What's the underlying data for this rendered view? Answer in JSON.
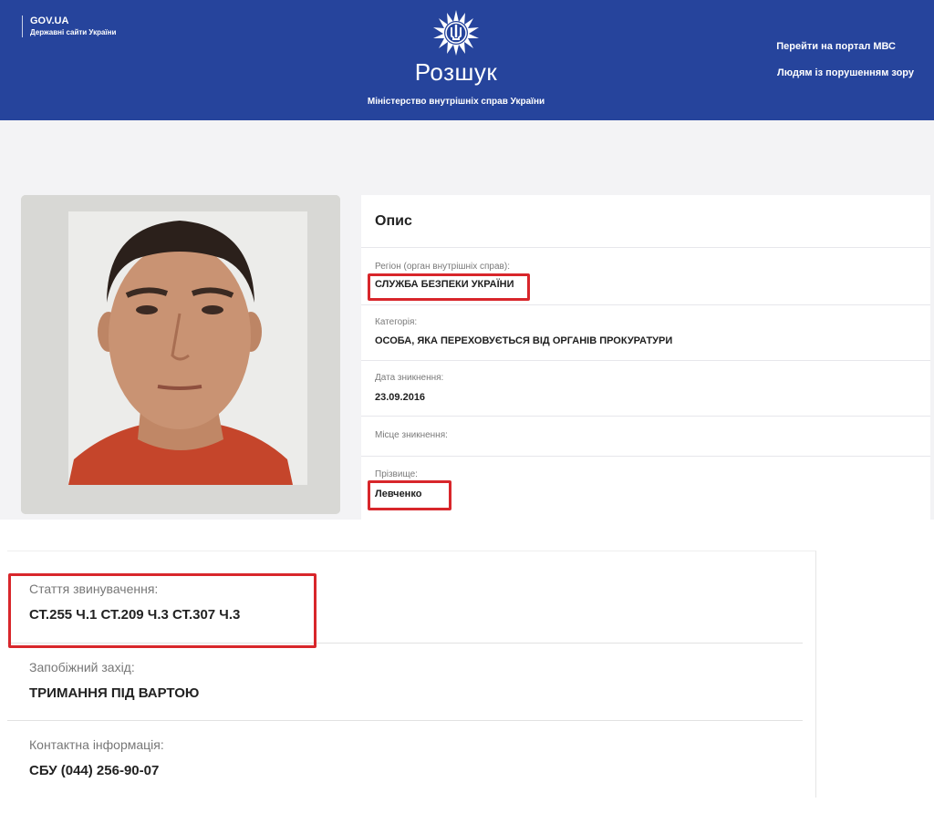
{
  "header": {
    "gov_title": "GOV.UA",
    "gov_subtitle": "Державні сайти України",
    "site_title": "Розшук",
    "site_subtitle": "Міністерство внутрішніх справ України",
    "link_portal": "Перейти на портал МВС",
    "link_vision": "Людям із порушенням зору",
    "emblem_icon": "police-star-trident-icon"
  },
  "card": {
    "title": "Опис",
    "fields": [
      {
        "label": "Регіон (орган внутрішніх справ):",
        "value": "СЛУЖБА БЕЗПЕКИ УКРАЇНИ"
      },
      {
        "label": "Категорія:",
        "value": "ОСОБА, ЯКА ПЕРЕХОВУЄТЬСЯ ВІД ОРГАНІВ ПРОКУРАТУРИ"
      },
      {
        "label": "Дата зникнення:",
        "value": "23.09.2016"
      },
      {
        "label": "Місце зникнення:",
        "value": ""
      },
      {
        "label": "Прізвище:",
        "value": "Левченко"
      }
    ]
  },
  "details": [
    {
      "label": "Стаття звинувачення:",
      "value": "СТ.255 Ч.1 СТ.209 Ч.3 СТ.307 Ч.3"
    },
    {
      "label": "Запобіжний захід:",
      "value": "ТРИМАННЯ ПІД ВАРТОЮ"
    },
    {
      "label": "Контактна інформація:",
      "value": "СБУ (044) 256-90-07"
    }
  ],
  "colors": {
    "header_bg": "#26449c",
    "highlight": "#d8262b"
  }
}
